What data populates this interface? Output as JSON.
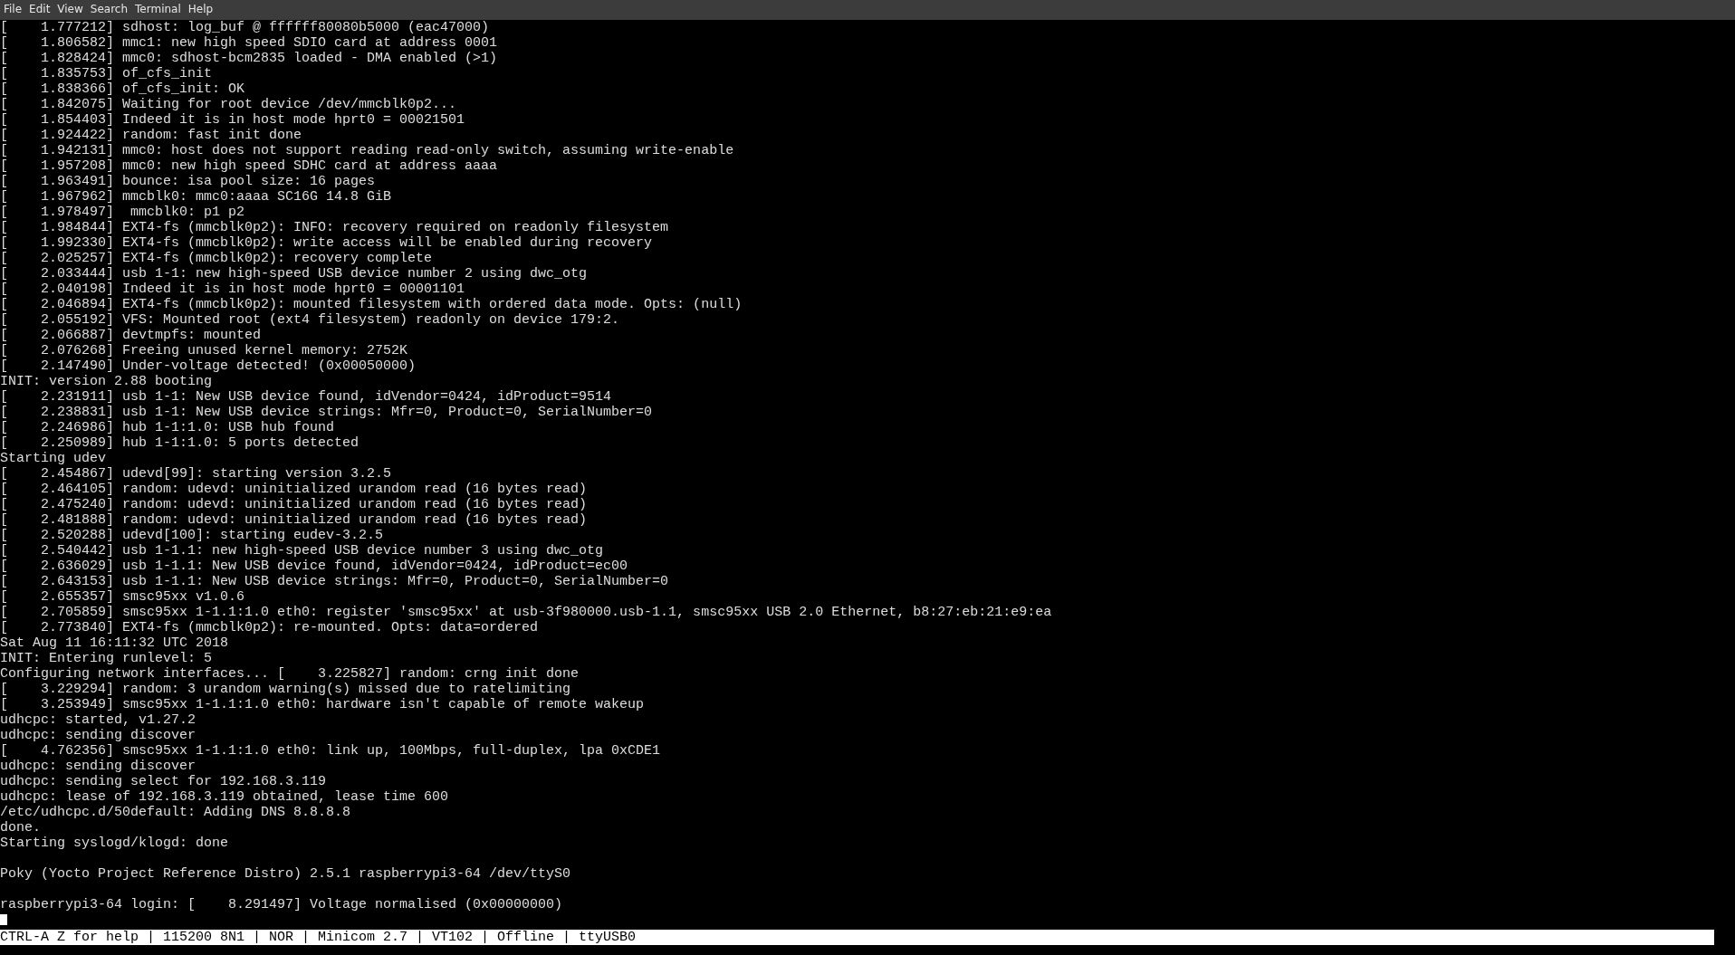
{
  "menu": [
    "File",
    "Edit",
    "View",
    "Search",
    "Terminal",
    "Help"
  ],
  "lines": [
    {
      "kind": "text",
      "text": "[    1.777212] sdhost: log_buf @ ffffff80080b5000 (eac47000)"
    },
    {
      "kind": "text",
      "text": "[    1.806582] mmc1: new high speed SDIO card at address 0001"
    },
    {
      "kind": "text",
      "text": "[    1.828424] mmc0: sdhost-bcm2835 loaded - DMA enabled (>1)"
    },
    {
      "kind": "text",
      "text": "[    1.835753] of_cfs_init"
    },
    {
      "kind": "text",
      "text": "[    1.838366] of_cfs_init: OK"
    },
    {
      "kind": "text",
      "text": "[    1.842075] Waiting for root device /dev/mmcblk0p2..."
    },
    {
      "kind": "text",
      "text": "[    1.854403] Indeed it is in host mode hprt0 = 00021501"
    },
    {
      "kind": "text",
      "text": "[    1.924422] random: fast init done"
    },
    {
      "kind": "text",
      "text": "[    1.942131] mmc0: host does not support reading read-only switch, assuming write-enable"
    },
    {
      "kind": "text",
      "text": "[    1.957208] mmc0: new high speed SDHC card at address aaaa"
    },
    {
      "kind": "text",
      "text": "[    1.963491] bounce: isa pool size: 16 pages"
    },
    {
      "kind": "text",
      "text": "[    1.967962] mmcblk0: mmc0:aaaa SC16G 14.8 GiB"
    },
    {
      "kind": "text",
      "text": "[    1.978497]  mmcblk0: p1 p2"
    },
    {
      "kind": "text",
      "text": "[    1.984844] EXT4-fs (mmcblk0p2): INFO: recovery required on readonly filesystem"
    },
    {
      "kind": "text",
      "text": "[    1.992330] EXT4-fs (mmcblk0p2): write access will be enabled during recovery"
    },
    {
      "kind": "text",
      "text": "[    2.025257] EXT4-fs (mmcblk0p2): recovery complete"
    },
    {
      "kind": "text",
      "text": "[    2.033444] usb 1-1: new high-speed USB device number 2 using dwc_otg"
    },
    {
      "kind": "text",
      "text": "[    2.040198] Indeed it is in host mode hprt0 = 00001101"
    },
    {
      "kind": "text",
      "text": "[    2.046894] EXT4-fs (mmcblk0p2): mounted filesystem with ordered data mode. Opts: (null)"
    },
    {
      "kind": "text",
      "text": "[    2.055192] VFS: Mounted root (ext4 filesystem) readonly on device 179:2."
    },
    {
      "kind": "text",
      "text": "[    2.066887] devtmpfs: mounted"
    },
    {
      "kind": "text",
      "text": "[    2.076268] Freeing unused kernel memory: 2752K"
    },
    {
      "kind": "text",
      "text": "[    2.147490] Under-voltage detected! (0x00050000)"
    },
    {
      "kind": "text",
      "text": "INIT: version 2.88 booting"
    },
    {
      "kind": "text",
      "text": "[    2.231911] usb 1-1: New USB device found, idVendor=0424, idProduct=9514"
    },
    {
      "kind": "text",
      "text": "[    2.238831] usb 1-1: New USB device strings: Mfr=0, Product=0, SerialNumber=0"
    },
    {
      "kind": "text",
      "text": "[    2.246986] hub 1-1:1.0: USB hub found"
    },
    {
      "kind": "text",
      "text": "[    2.250989] hub 1-1:1.0: 5 ports detected"
    },
    {
      "kind": "text",
      "text": "Starting udev"
    },
    {
      "kind": "text",
      "text": "[    2.454867] udevd[99]: starting version 3.2.5"
    },
    {
      "kind": "text",
      "text": "[    2.464105] random: udevd: uninitialized urandom read (16 bytes read)"
    },
    {
      "kind": "text",
      "text": "[    2.475240] random: udevd: uninitialized urandom read (16 bytes read)"
    },
    {
      "kind": "text",
      "text": "[    2.481888] random: udevd: uninitialized urandom read (16 bytes read)"
    },
    {
      "kind": "text",
      "text": "[    2.520288] udevd[100]: starting eudev-3.2.5"
    },
    {
      "kind": "text",
      "text": "[    2.540442] usb 1-1.1: new high-speed USB device number 3 using dwc_otg"
    },
    {
      "kind": "text",
      "text": "[    2.636029] usb 1-1.1: New USB device found, idVendor=0424, idProduct=ec00"
    },
    {
      "kind": "text",
      "text": "[    2.643153] usb 1-1.1: New USB device strings: Mfr=0, Product=0, SerialNumber=0"
    },
    {
      "kind": "text",
      "text": "[    2.655357] smsc95xx v1.0.6"
    },
    {
      "kind": "text",
      "text": "[    2.705859] smsc95xx 1-1.1:1.0 eth0: register 'smsc95xx' at usb-3f980000.usb-1.1, smsc95xx USB 2.0 Ethernet, b8:27:eb:21:e9:ea"
    },
    {
      "kind": "text",
      "text": "[    2.773840] EXT4-fs (mmcblk0p2): re-mounted. Opts: data=ordered"
    },
    {
      "kind": "text",
      "text": "Sat Aug 11 16:11:32 UTC 2018"
    },
    {
      "kind": "text",
      "text": "INIT: Entering runlevel: 5"
    },
    {
      "kind": "text",
      "text": "Configuring network interfaces... [    3.225827] random: crng init done"
    },
    {
      "kind": "text",
      "text": "[    3.229294] random: 3 urandom warning(s) missed due to ratelimiting"
    },
    {
      "kind": "text",
      "text": "[    3.253949] smsc95xx 1-1.1:1.0 eth0: hardware isn't capable of remote wakeup"
    },
    {
      "kind": "text",
      "text": "udhcpc: started, v1.27.2"
    },
    {
      "kind": "text",
      "text": "udhcpc: sending discover"
    },
    {
      "kind": "text",
      "text": "[    4.762356] smsc95xx 1-1.1:1.0 eth0: link up, 100Mbps, full-duplex, lpa 0xCDE1"
    },
    {
      "kind": "text",
      "text": "udhcpc: sending discover"
    },
    {
      "kind": "text",
      "text": "udhcpc: sending select for 192.168.3.119"
    },
    {
      "kind": "text",
      "text": "udhcpc: lease of 192.168.3.119 obtained, lease time 600"
    },
    {
      "kind": "text",
      "text": "/etc/udhcpc.d/50default: Adding DNS 8.8.8.8"
    },
    {
      "kind": "text",
      "text": "done."
    },
    {
      "kind": "text",
      "text": "Starting syslogd/klogd: done"
    },
    {
      "kind": "blank"
    },
    {
      "kind": "text",
      "text": "Poky (Yocto Project Reference Distro) 2.5.1 raspberrypi3-64 /dev/ttyS0"
    },
    {
      "kind": "blank"
    },
    {
      "kind": "text",
      "text": "raspberrypi3-64 login: [    8.291497] Voltage normalised (0x00000000)"
    }
  ],
  "status_bar": "CTRL-A Z for help | 115200 8N1 | NOR | Minicom 2.7 | VT102 | Offline | ttyUSB0"
}
